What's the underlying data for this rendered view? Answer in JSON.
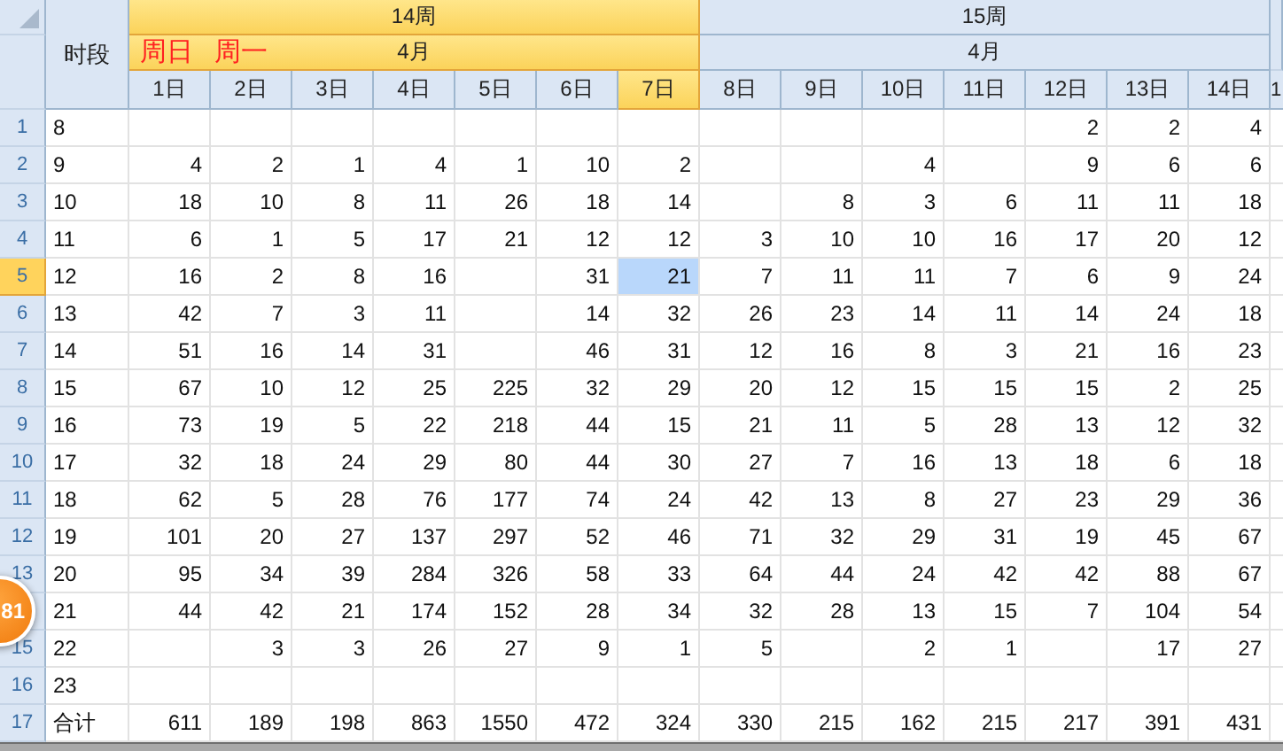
{
  "corner_label": "时段",
  "weeks": [
    {
      "label": "14周",
      "month": "4月",
      "selected": true,
      "notes": [
        "周日",
        "周一"
      ]
    },
    {
      "label": "15周",
      "month": "4月",
      "selected": false
    }
  ],
  "columns": [
    {
      "label": "1日",
      "selected": false
    },
    {
      "label": "2日",
      "selected": false
    },
    {
      "label": "3日",
      "selected": false
    },
    {
      "label": "4日",
      "selected": false
    },
    {
      "label": "5日",
      "selected": false
    },
    {
      "label": "6日",
      "selected": false
    },
    {
      "label": "7日",
      "selected": true
    },
    {
      "label": "8日",
      "selected": false
    },
    {
      "label": "9日",
      "selected": false
    },
    {
      "label": "10日",
      "selected": false
    },
    {
      "label": "11日",
      "selected": false
    },
    {
      "label": "12日",
      "selected": false
    },
    {
      "label": "13日",
      "selected": false
    },
    {
      "label": "14日",
      "selected": false
    }
  ],
  "partial_column": {
    "label": "1"
  },
  "rows": [
    {
      "num": "1",
      "selected": false,
      "slot": "8",
      "values": [
        {
          "kind": "empty"
        },
        {
          "kind": "empty"
        },
        {
          "kind": "empty"
        },
        {
          "kind": "empty"
        },
        {
          "kind": "empty"
        },
        {
          "kind": "empty"
        },
        {
          "kind": "empty"
        },
        {
          "kind": "empty"
        },
        {
          "kind": "empty"
        },
        {
          "kind": "empty"
        },
        {
          "kind": "empty"
        },
        {
          "kind": "number",
          "value": "2"
        },
        {
          "kind": "number",
          "value": "2"
        },
        {
          "kind": "number",
          "value": "4"
        }
      ]
    },
    {
      "num": "2",
      "selected": false,
      "slot": "9",
      "values": [
        {
          "kind": "number",
          "value": "4"
        },
        {
          "kind": "number",
          "value": "2"
        },
        {
          "kind": "number",
          "value": "1"
        },
        {
          "kind": "number",
          "value": "4"
        },
        {
          "kind": "number",
          "value": "1"
        },
        {
          "kind": "number",
          "value": "10"
        },
        {
          "kind": "number",
          "value": "2"
        },
        {
          "kind": "empty"
        },
        {
          "kind": "empty"
        },
        {
          "kind": "number",
          "value": "4"
        },
        {
          "kind": "empty"
        },
        {
          "kind": "number",
          "value": "9"
        },
        {
          "kind": "number",
          "value": "6"
        },
        {
          "kind": "number",
          "value": "6"
        }
      ]
    },
    {
      "num": "3",
      "selected": false,
      "slot": "10",
      "values": [
        {
          "kind": "number",
          "value": "18"
        },
        {
          "kind": "number",
          "value": "10"
        },
        {
          "kind": "number",
          "value": "8"
        },
        {
          "kind": "number",
          "value": "11"
        },
        {
          "kind": "number",
          "value": "26"
        },
        {
          "kind": "number",
          "value": "18"
        },
        {
          "kind": "number",
          "value": "14"
        },
        {
          "kind": "empty"
        },
        {
          "kind": "number",
          "value": "8"
        },
        {
          "kind": "number",
          "value": "3"
        },
        {
          "kind": "number",
          "value": "6"
        },
        {
          "kind": "number",
          "value": "11"
        },
        {
          "kind": "number",
          "value": "11"
        },
        {
          "kind": "number",
          "value": "18"
        }
      ]
    },
    {
      "num": "4",
      "selected": false,
      "slot": "11",
      "values": [
        {
          "kind": "number",
          "value": "6"
        },
        {
          "kind": "number",
          "value": "1"
        },
        {
          "kind": "number",
          "value": "5"
        },
        {
          "kind": "number",
          "value": "17"
        },
        {
          "kind": "number",
          "value": "21"
        },
        {
          "kind": "number",
          "value": "12"
        },
        {
          "kind": "number",
          "value": "12"
        },
        {
          "kind": "number",
          "value": "3"
        },
        {
          "kind": "number",
          "value": "10"
        },
        {
          "kind": "number",
          "value": "10"
        },
        {
          "kind": "number",
          "value": "16"
        },
        {
          "kind": "number",
          "value": "17"
        },
        {
          "kind": "number",
          "value": "20"
        },
        {
          "kind": "number",
          "value": "12"
        }
      ]
    },
    {
      "num": "5",
      "selected": true,
      "slot": "12",
      "values": [
        {
          "kind": "number",
          "value": "16"
        },
        {
          "kind": "number",
          "value": "2"
        },
        {
          "kind": "number",
          "value": "8"
        },
        {
          "kind": "number",
          "value": "16"
        },
        {
          "kind": "empty"
        },
        {
          "kind": "number",
          "value": "31"
        },
        {
          "kind": "number",
          "value": "21"
        },
        {
          "kind": "number",
          "value": "7"
        },
        {
          "kind": "number",
          "value": "11"
        },
        {
          "kind": "number",
          "value": "11"
        },
        {
          "kind": "number",
          "value": "7"
        },
        {
          "kind": "number",
          "value": "6"
        },
        {
          "kind": "number",
          "value": "9"
        },
        {
          "kind": "number",
          "value": "24"
        }
      ]
    },
    {
      "num": "6",
      "selected": false,
      "slot": "13",
      "values": [
        {
          "kind": "number",
          "value": "42"
        },
        {
          "kind": "number",
          "value": "7"
        },
        {
          "kind": "number",
          "value": "3"
        },
        {
          "kind": "number",
          "value": "11"
        },
        {
          "kind": "empty"
        },
        {
          "kind": "number",
          "value": "14"
        },
        {
          "kind": "number",
          "value": "32"
        },
        {
          "kind": "number",
          "value": "26"
        },
        {
          "kind": "number",
          "value": "23"
        },
        {
          "kind": "number",
          "value": "14"
        },
        {
          "kind": "number",
          "value": "11"
        },
        {
          "kind": "number",
          "value": "14"
        },
        {
          "kind": "number",
          "value": "24"
        },
        {
          "kind": "number",
          "value": "18"
        }
      ]
    },
    {
      "num": "7",
      "selected": false,
      "slot": "14",
      "values": [
        {
          "kind": "number",
          "value": "51"
        },
        {
          "kind": "number",
          "value": "16"
        },
        {
          "kind": "number",
          "value": "14"
        },
        {
          "kind": "number",
          "value": "31"
        },
        {
          "kind": "empty"
        },
        {
          "kind": "number",
          "value": "46"
        },
        {
          "kind": "number",
          "value": "31"
        },
        {
          "kind": "number",
          "value": "12"
        },
        {
          "kind": "number",
          "value": "16"
        },
        {
          "kind": "number",
          "value": "8"
        },
        {
          "kind": "number",
          "value": "3"
        },
        {
          "kind": "number",
          "value": "21"
        },
        {
          "kind": "number",
          "value": "16"
        },
        {
          "kind": "number",
          "value": "23"
        }
      ]
    },
    {
      "num": "8",
      "selected": false,
      "slot": "15",
      "values": [
        {
          "kind": "number",
          "value": "67"
        },
        {
          "kind": "number",
          "value": "10"
        },
        {
          "kind": "number",
          "value": "12"
        },
        {
          "kind": "number",
          "value": "25"
        },
        {
          "kind": "number",
          "value": "225"
        },
        {
          "kind": "number",
          "value": "32"
        },
        {
          "kind": "number",
          "value": "29"
        },
        {
          "kind": "number",
          "value": "20"
        },
        {
          "kind": "number",
          "value": "12"
        },
        {
          "kind": "number",
          "value": "15"
        },
        {
          "kind": "number",
          "value": "15"
        },
        {
          "kind": "number",
          "value": "15"
        },
        {
          "kind": "number",
          "value": "2"
        },
        {
          "kind": "number",
          "value": "25"
        }
      ]
    },
    {
      "num": "9",
      "selected": false,
      "slot": "16",
      "values": [
        {
          "kind": "number",
          "value": "73"
        },
        {
          "kind": "number",
          "value": "19"
        },
        {
          "kind": "number",
          "value": "5"
        },
        {
          "kind": "number",
          "value": "22"
        },
        {
          "kind": "number",
          "value": "218"
        },
        {
          "kind": "number",
          "value": "44"
        },
        {
          "kind": "number",
          "value": "15"
        },
        {
          "kind": "number",
          "value": "21"
        },
        {
          "kind": "number",
          "value": "11"
        },
        {
          "kind": "number",
          "value": "5"
        },
        {
          "kind": "number",
          "value": "28"
        },
        {
          "kind": "number",
          "value": "13"
        },
        {
          "kind": "number",
          "value": "12"
        },
        {
          "kind": "number",
          "value": "32"
        }
      ]
    },
    {
      "num": "10",
      "selected": false,
      "slot": "17",
      "values": [
        {
          "kind": "number",
          "value": "32"
        },
        {
          "kind": "number",
          "value": "18"
        },
        {
          "kind": "number",
          "value": "24"
        },
        {
          "kind": "number",
          "value": "29"
        },
        {
          "kind": "number",
          "value": "80"
        },
        {
          "kind": "number",
          "value": "44"
        },
        {
          "kind": "number",
          "value": "30"
        },
        {
          "kind": "number",
          "value": "27"
        },
        {
          "kind": "number",
          "value": "7"
        },
        {
          "kind": "number",
          "value": "16"
        },
        {
          "kind": "number",
          "value": "13"
        },
        {
          "kind": "number",
          "value": "18"
        },
        {
          "kind": "number",
          "value": "6"
        },
        {
          "kind": "number",
          "value": "18"
        }
      ]
    },
    {
      "num": "11",
      "selected": false,
      "slot": "18",
      "values": [
        {
          "kind": "number",
          "value": "62"
        },
        {
          "kind": "number",
          "value": "5"
        },
        {
          "kind": "number",
          "value": "28"
        },
        {
          "kind": "number",
          "value": "76"
        },
        {
          "kind": "number",
          "value": "177"
        },
        {
          "kind": "number",
          "value": "74"
        },
        {
          "kind": "number",
          "value": "24"
        },
        {
          "kind": "number",
          "value": "42"
        },
        {
          "kind": "number",
          "value": "13"
        },
        {
          "kind": "number",
          "value": "8"
        },
        {
          "kind": "number",
          "value": "27"
        },
        {
          "kind": "number",
          "value": "23"
        },
        {
          "kind": "number",
          "value": "29"
        },
        {
          "kind": "number",
          "value": "36"
        }
      ]
    },
    {
      "num": "12",
      "selected": false,
      "slot": "19",
      "values": [
        {
          "kind": "number",
          "value": "101"
        },
        {
          "kind": "number",
          "value": "20"
        },
        {
          "kind": "number",
          "value": "27"
        },
        {
          "kind": "number",
          "value": "137"
        },
        {
          "kind": "number",
          "value": "297"
        },
        {
          "kind": "number",
          "value": "52"
        },
        {
          "kind": "number",
          "value": "46"
        },
        {
          "kind": "number",
          "value": "71"
        },
        {
          "kind": "number",
          "value": "32"
        },
        {
          "kind": "number",
          "value": "29"
        },
        {
          "kind": "number",
          "value": "31"
        },
        {
          "kind": "number",
          "value": "19"
        },
        {
          "kind": "number",
          "value": "45"
        },
        {
          "kind": "number",
          "value": "67"
        }
      ]
    },
    {
      "num": "13",
      "selected": false,
      "slot": "20",
      "values": [
        {
          "kind": "number",
          "value": "95"
        },
        {
          "kind": "number",
          "value": "34"
        },
        {
          "kind": "number",
          "value": "39"
        },
        {
          "kind": "number",
          "value": "284"
        },
        {
          "kind": "number",
          "value": "326"
        },
        {
          "kind": "number",
          "value": "58"
        },
        {
          "kind": "number",
          "value": "33"
        },
        {
          "kind": "number",
          "value": "64"
        },
        {
          "kind": "number",
          "value": "44"
        },
        {
          "kind": "number",
          "value": "24"
        },
        {
          "kind": "number",
          "value": "42"
        },
        {
          "kind": "number",
          "value": "42"
        },
        {
          "kind": "number",
          "value": "88"
        },
        {
          "kind": "number",
          "value": "67"
        }
      ]
    },
    {
      "selected": false,
      "slot": "21",
      "values": [
        {
          "kind": "number",
          "value": "44"
        },
        {
          "kind": "number",
          "value": "42"
        },
        {
          "kind": "number",
          "value": "21"
        },
        {
          "kind": "number",
          "value": "174"
        },
        {
          "kind": "number",
          "value": "152"
        },
        {
          "kind": "number",
          "value": "28"
        },
        {
          "kind": "number",
          "value": "34"
        },
        {
          "kind": "number",
          "value": "32"
        },
        {
          "kind": "number",
          "value": "28"
        },
        {
          "kind": "number",
          "value": "13"
        },
        {
          "kind": "number",
          "value": "15"
        },
        {
          "kind": "number",
          "value": "7"
        },
        {
          "kind": "number",
          "value": "104"
        },
        {
          "kind": "number",
          "value": "54"
        }
      ]
    },
    {
      "num": "15",
      "selected": false,
      "slot": "22",
      "values": [
        {
          "kind": "empty"
        },
        {
          "kind": "number",
          "value": "3"
        },
        {
          "kind": "number",
          "value": "3"
        },
        {
          "kind": "number",
          "value": "26"
        },
        {
          "kind": "number",
          "value": "27"
        },
        {
          "kind": "number",
          "value": "9"
        },
        {
          "kind": "number",
          "value": "1"
        },
        {
          "kind": "number",
          "value": "5"
        },
        {
          "kind": "empty"
        },
        {
          "kind": "number",
          "value": "2"
        },
        {
          "kind": "number",
          "value": "1"
        },
        {
          "kind": "empty"
        },
        {
          "kind": "number",
          "value": "17"
        },
        {
          "kind": "number",
          "value": "27"
        }
      ]
    },
    {
      "num": "16",
      "selected": false,
      "slot": "23",
      "values": [
        {
          "kind": "empty"
        },
        {
          "kind": "empty"
        },
        {
          "kind": "empty"
        },
        {
          "kind": "empty"
        },
        {
          "kind": "empty"
        },
        {
          "kind": "empty"
        },
        {
          "kind": "empty"
        },
        {
          "kind": "empty"
        },
        {
          "kind": "empty"
        },
        {
          "kind": "empty"
        },
        {
          "kind": "empty"
        },
        {
          "kind": "empty"
        },
        {
          "kind": "empty"
        },
        {
          "kind": "empty"
        }
      ]
    },
    {
      "num": "17",
      "selected": false,
      "slot": "合计",
      "values": [
        {
          "kind": "number",
          "value": "611"
        },
        {
          "kind": "number",
          "value": "189"
        },
        {
          "kind": "number",
          "value": "198"
        },
        {
          "kind": "number",
          "value": "863"
        },
        {
          "kind": "number",
          "value": "1550"
        },
        {
          "kind": "number",
          "value": "472"
        },
        {
          "kind": "number",
          "value": "324"
        },
        {
          "kind": "number",
          "value": "330"
        },
        {
          "kind": "number",
          "value": "215"
        },
        {
          "kind": "number",
          "value": "162"
        },
        {
          "kind": "number",
          "value": "215"
        },
        {
          "kind": "number",
          "value": "217"
        },
        {
          "kind": "number",
          "value": "391"
        },
        {
          "kind": "number",
          "value": "431"
        }
      ]
    }
  ],
  "badge": {
    "text": "81"
  }
}
